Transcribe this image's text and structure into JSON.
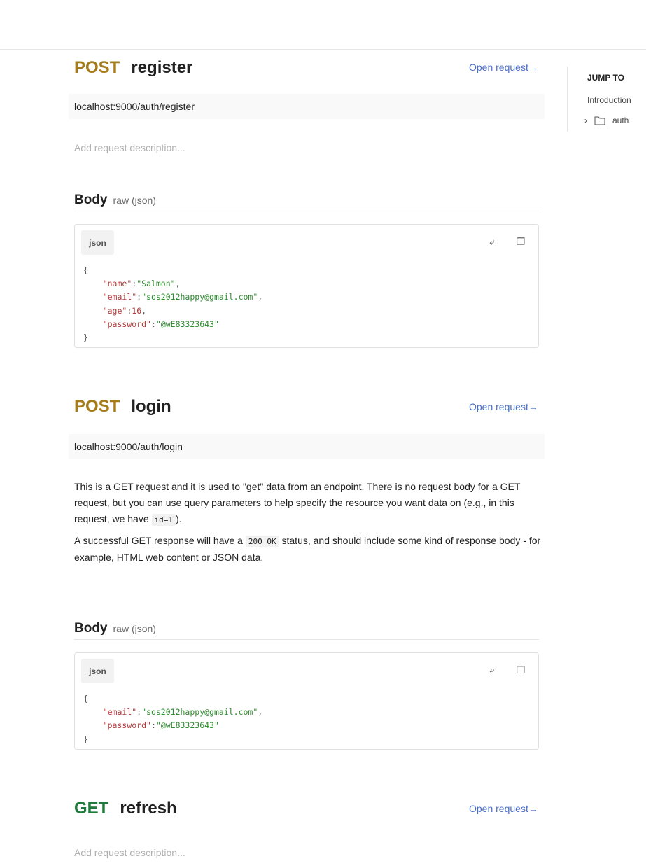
{
  "sidebar": {
    "heading": "JUMP TO",
    "intro": "Introduction",
    "folder": "auth"
  },
  "open_label": "Open request→",
  "body_heading": "Body",
  "body_type": "raw (json)",
  "tab_label": "json",
  "desc_placeholder": "Add request description...",
  "requests": [
    {
      "method": "POST",
      "name": "register",
      "url": "localhost:9000/auth/register",
      "code": [
        [
          "{"
        ],
        [
          "    ",
          [
            "k",
            "\"name\""
          ],
          ":",
          [
            "s",
            "\"Salmon\""
          ],
          ","
        ],
        [
          "    ",
          [
            "k",
            "\"email\""
          ],
          ":",
          [
            "s",
            "\"sos2012happy@gmail.com\""
          ],
          ","
        ],
        [
          "    ",
          [
            "k",
            "\"age\""
          ],
          ":",
          [
            "n",
            "16"
          ],
          ","
        ],
        [
          "    ",
          [
            "k",
            "\"password\""
          ],
          ":",
          [
            "s",
            "\"@wE83323643\""
          ]
        ],
        [
          "}"
        ]
      ]
    },
    {
      "method": "POST",
      "name": "login",
      "url": "localhost:9000/auth/login",
      "desc": {
        "p1a": "This is a GET request and it is used to \"get\" data from an endpoint. There is no request body for a GET request, but you can use query parameters to help specify the resource you want data on (e.g., in this request, we have ",
        "p1code": "id=1",
        "p1b": ").",
        "p2a": "A successful GET response will have a ",
        "p2code": "200 OK",
        "p2b": " status, and should include some kind of response body - for example, HTML web content or JSON data."
      },
      "code": [
        [
          "{"
        ],
        [
          "    ",
          [
            "k",
            "\"email\""
          ],
          ":",
          [
            "s",
            "\"sos2012happy@gmail.com\""
          ],
          ","
        ],
        [
          "    ",
          [
            "k",
            "\"password\""
          ],
          ":",
          [
            "s",
            "\"@wE83323643\""
          ]
        ],
        [
          "}"
        ]
      ]
    },
    {
      "method": "GET",
      "name": "refresh"
    }
  ]
}
